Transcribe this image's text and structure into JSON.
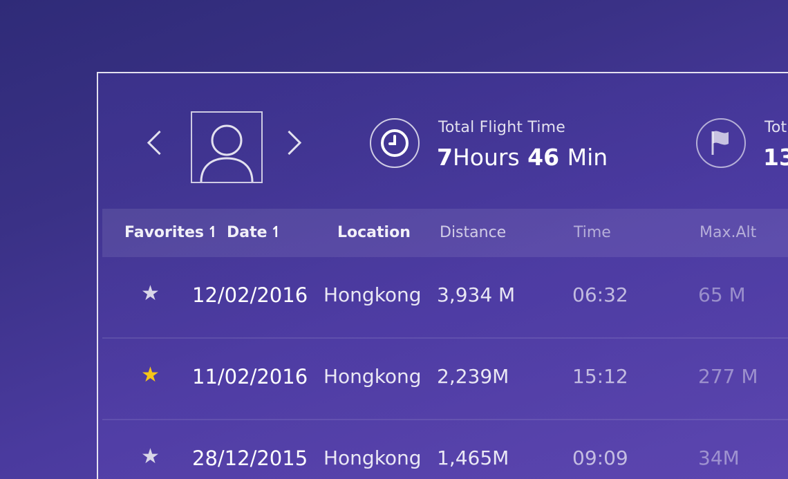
{
  "header": {
    "stats": [
      {
        "label": "Total Flight Time",
        "value_hours": "7",
        "unit_hours": "Hours",
        "value_min": "46",
        "unit_min": "Min",
        "icon": "clock-icon"
      },
      {
        "label": "Tot",
        "value": "13",
        "icon": "flag-icon"
      }
    ]
  },
  "table": {
    "columns": [
      "Favorites",
      "Date",
      "Location",
      "Distance",
      "Time",
      "Max.Alt"
    ],
    "rows": [
      {
        "favorite": false,
        "date": "12/02/2016",
        "location": "Hongkong",
        "distance": "3,934 M",
        "time": "06:32",
        "max_alt": "65 M"
      },
      {
        "favorite": true,
        "date": "11/02/2016",
        "location": "Hongkong",
        "distance": "2,239M",
        "time": "15:12",
        "max_alt": "277 M"
      },
      {
        "favorite": false,
        "date": "28/12/2015",
        "location": "Hongkong",
        "distance": "1,465M",
        "time": "09:09",
        "max_alt": "34M"
      }
    ]
  },
  "colors": {
    "star_active": "#f5c518",
    "star_inactive": "#d9d6e8",
    "background": "#3a3186"
  }
}
